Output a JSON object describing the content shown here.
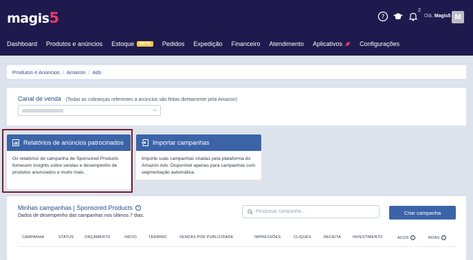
{
  "brand": {
    "name": "magis",
    "number": "5"
  },
  "header": {
    "greeting_prefix": "Olá,",
    "user_name": "Magis5",
    "avatar_initial": "M",
    "notification_count": "2"
  },
  "nav": {
    "items": [
      {
        "label": "Dashboard"
      },
      {
        "label": "Produtos e anúncios"
      },
      {
        "label": "Estoque",
        "badge": "BETA"
      },
      {
        "label": "Pedidos"
      },
      {
        "label": "Expedição"
      },
      {
        "label": "Financeiro"
      },
      {
        "label": "Atendimento"
      },
      {
        "label": "Aplicativos"
      },
      {
        "label": "Configurações"
      }
    ]
  },
  "breadcrumb": [
    "Produtos e Anúncios",
    "Amazon",
    "Ads"
  ],
  "channel": {
    "title": "Canal de venda",
    "note": "(Todas as cobranças referentes a anúncios são feitas diretamente pela Amazon)"
  },
  "cards": {
    "reports": {
      "title": "Relatórios de anúncios patrocinados",
      "body": "Os relatórios de campanha de Sponsored Products fornecem insights sobre vendas e desempenho de produtos anunciados e muito mais."
    },
    "import": {
      "title": "Importar campanhas",
      "body": "Importe suas campanhas criadas pela plataforma do Amazon Ads. Disponível apenas para campanhas com segmentação automática."
    }
  },
  "campaigns": {
    "title": "Minhas campanhas | Sponsored Products",
    "subtitle": "Dados de desempenho das campanhas nos últimos 7 dias.",
    "search_placeholder": "Pesquisar campanha...",
    "create_label": "Criar campanha",
    "columns": [
      "CAMPANHA",
      "STATUS",
      "ORÇAMENTO",
      "INÍCIO",
      "TÉRMINO",
      "VENDAS POR PUBLICIDADE",
      "IMPRESSÕES",
      "CLIQUES",
      "RECEITA",
      "INVESTIMENTO",
      "ACOS",
      "ROAS"
    ]
  },
  "colors": {
    "header_bg": "#1f1a4d",
    "accent": "#3b63a8",
    "brand_pink": "#e83b6a",
    "beta_badge": "#f2c94c",
    "highlight_border": "#7a1b2b"
  }
}
